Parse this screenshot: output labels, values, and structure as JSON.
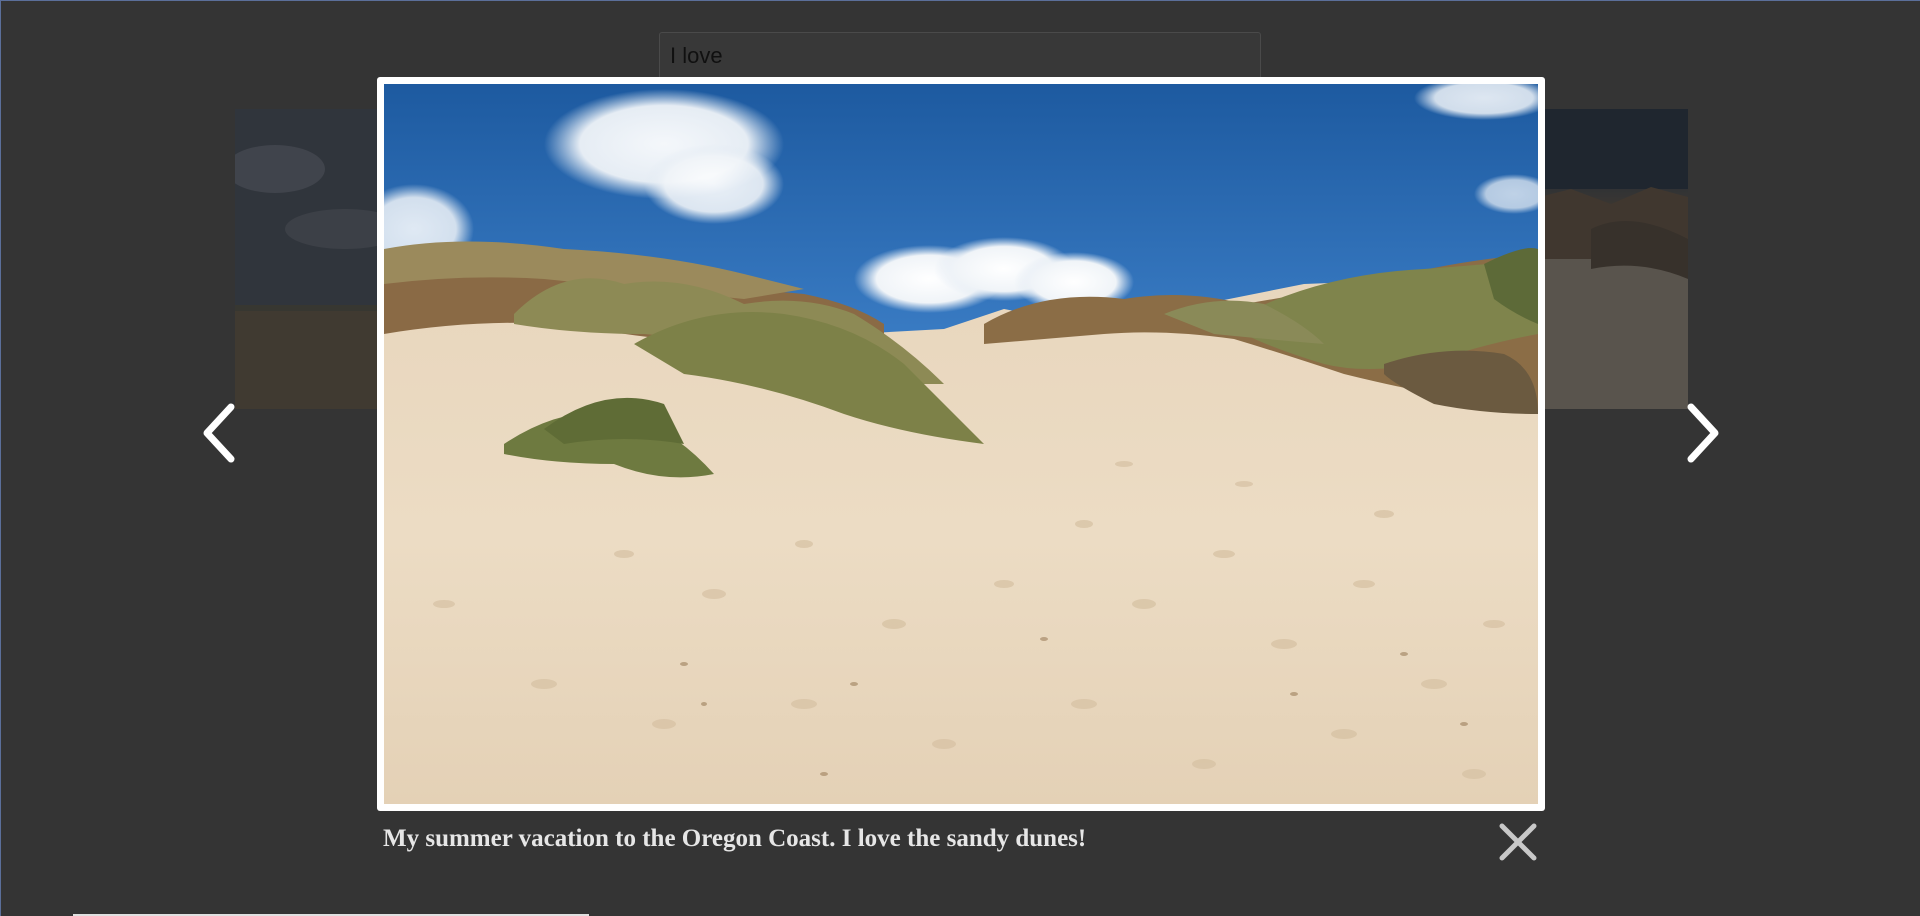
{
  "search": {
    "value": "I love"
  },
  "lightbox": {
    "caption": "My summer vacation to the Oregon Coast. I love the sandy dunes!",
    "image_subject": "sand-dunes-photo",
    "prev_icon": "chevron-left-icon",
    "next_icon": "chevron-right-icon",
    "close_icon": "close-icon"
  },
  "colors": {
    "overlay_background": "#343434",
    "frame": "#ffffff",
    "caption_text": "#e6e6e6",
    "arrow": "#ffffff",
    "close": "#c8c8c8"
  }
}
